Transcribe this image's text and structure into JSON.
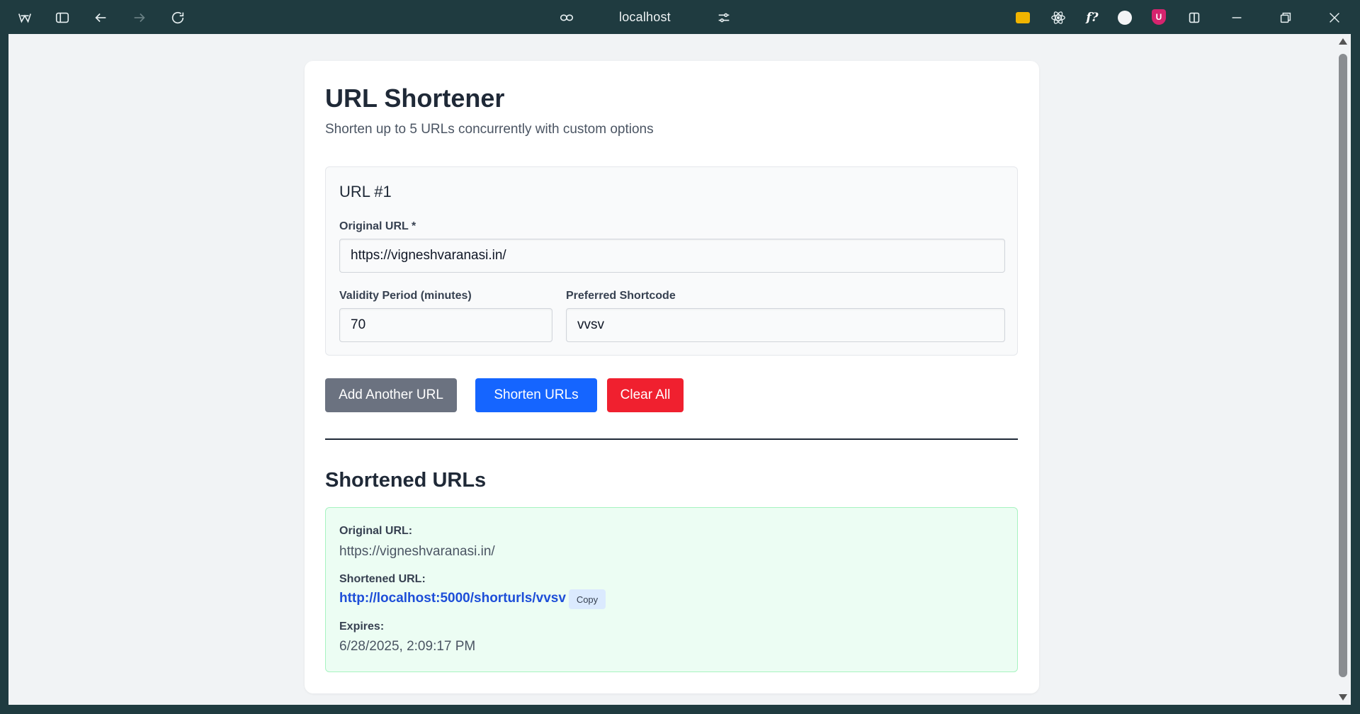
{
  "browser": {
    "address": "localhost",
    "icons": [
      "app-logo-icon",
      "sidebar-toggle-icon",
      "back-icon",
      "forward-icon",
      "reload-icon",
      "link-icon",
      "site-settings-icon",
      "extension-folder-icon",
      "react-devtools-icon",
      "font-identifier-icon",
      "extension-circle-icon",
      "ublock-icon",
      "split-view-icon",
      "minimize-icon",
      "restore-icon",
      "close-icon"
    ],
    "ext_font_label": "f?",
    "ext_ublock_label": "U"
  },
  "page": {
    "title": "URL Shortener",
    "subtitle": "Shorten up to 5 URLs concurrently with custom options"
  },
  "entry": {
    "heading": "URL #1",
    "original_url_label": "Original URL *",
    "original_url_value": "https://vigneshvaranasi.in/",
    "validity_label": "Validity Period (minutes)",
    "validity_value": "70",
    "shortcode_label": "Preferred Shortcode",
    "shortcode_value": "vvsv"
  },
  "actions": {
    "add_label": "Add Another URL",
    "shorten_label": "Shorten URLs",
    "clear_label": "Clear All"
  },
  "results": {
    "heading": "Shortened URLs",
    "items": [
      {
        "original_label": "Original URL:",
        "original_value": "https://vigneshvaranasi.in/",
        "short_label": "Shortened URL:",
        "short_value": "http://localhost:5000/shorturls/vvsv",
        "copy_label": "Copy",
        "expires_label": "Expires:",
        "expires_value": "6/28/2025, 2:09:17 PM"
      }
    ]
  },
  "colors": {
    "chrome": "#1f3b40",
    "primary": "#1565ff",
    "danger": "#f0202f",
    "secondary": "#6b7280",
    "success_bg": "#ecfdf3",
    "link": "#1d4ed8"
  }
}
